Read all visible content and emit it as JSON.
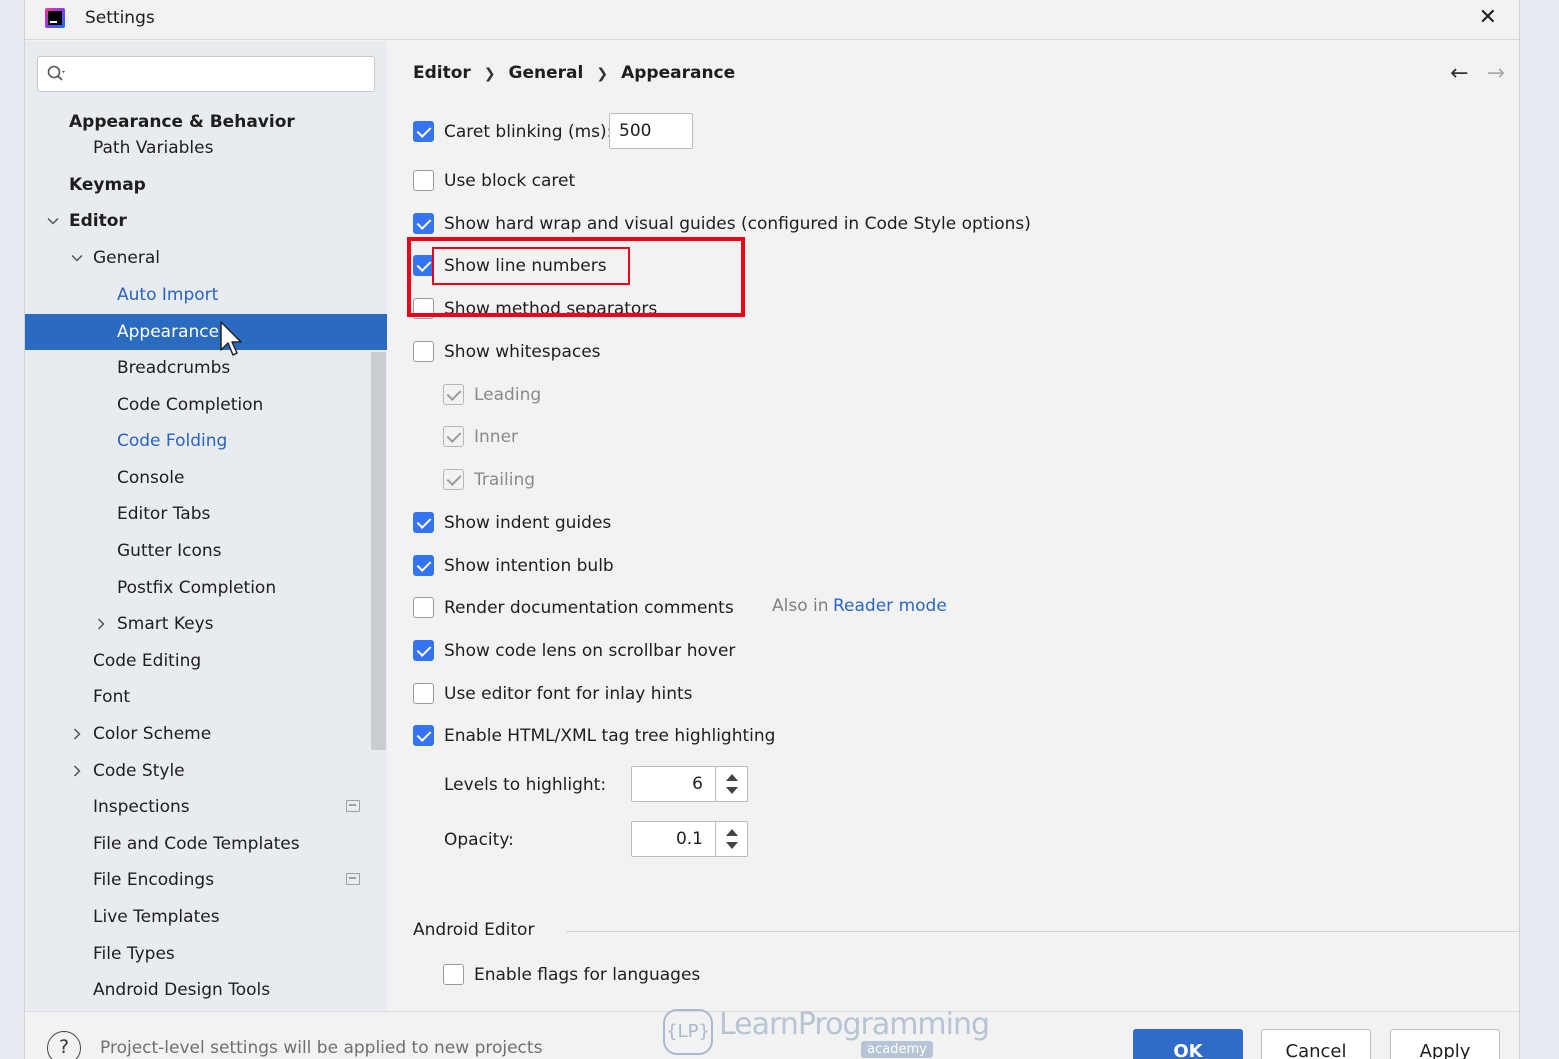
{
  "window": {
    "title": "Settings"
  },
  "sidebar": {
    "search": {
      "placeholder": ""
    },
    "items": [
      {
        "label": "Appearance & Behavior"
      },
      {
        "label": "Path Variables"
      },
      {
        "label": "Keymap"
      },
      {
        "label": "Editor"
      },
      {
        "label": "General"
      },
      {
        "label": "Auto Import"
      },
      {
        "label": "Appearance"
      },
      {
        "label": "Breadcrumbs"
      },
      {
        "label": "Code Completion"
      },
      {
        "label": "Code Folding"
      },
      {
        "label": "Console"
      },
      {
        "label": "Editor Tabs"
      },
      {
        "label": "Gutter Icons"
      },
      {
        "label": "Postfix Completion"
      },
      {
        "label": "Smart Keys"
      },
      {
        "label": "Code Editing"
      },
      {
        "label": "Font"
      },
      {
        "label": "Color Scheme"
      },
      {
        "label": "Code Style"
      },
      {
        "label": "Inspections"
      },
      {
        "label": "File and Code Templates"
      },
      {
        "label": "File Encodings"
      },
      {
        "label": "Live Templates"
      },
      {
        "label": "File Types"
      },
      {
        "label": "Android Design Tools"
      }
    ]
  },
  "breadcrumb": [
    "Editor",
    "General",
    "Appearance"
  ],
  "options": [
    {
      "label": "Caret blinking (ms):",
      "checked": true
    },
    {
      "label": "Use block caret",
      "checked": false
    },
    {
      "label": "Show hard wrap and visual guides (configured in Code Style options)",
      "checked": true
    },
    {
      "label": "Show line numbers",
      "checked": true
    },
    {
      "label": "Show method separators",
      "checked": false
    },
    {
      "label": "Show whitespaces",
      "checked": false
    },
    {
      "label": "Leading",
      "checked": true
    },
    {
      "label": "Inner",
      "checked": true
    },
    {
      "label": "Trailing",
      "checked": true
    },
    {
      "label": "Show indent guides",
      "checked": true
    },
    {
      "label": "Show intention bulb",
      "checked": true
    },
    {
      "label": "Render documentation comments",
      "checked": false
    },
    {
      "label": "Show code lens on scrollbar hover",
      "checked": true
    },
    {
      "label": "Use editor font for inlay hints",
      "checked": false
    },
    {
      "label": "Enable HTML/XML tag tree highlighting",
      "checked": true
    },
    {
      "label": "Enable flags for languages",
      "checked": false
    }
  ],
  "caret_blinking_value": "500",
  "also_in": {
    "prefix": "Also in",
    "link": "Reader mode"
  },
  "levels": {
    "label": "Levels to highlight:",
    "value": "6"
  },
  "opacity": {
    "label": "Opacity:",
    "value": "0.1"
  },
  "section_android": "Android Editor",
  "footer": {
    "help": "?",
    "note": "Project-level settings will be applied to new projects",
    "ok": "OK",
    "cancel": "Cancel",
    "apply": "Apply"
  },
  "watermark": {
    "badge": "{LP}",
    "text": "LearnProgramming",
    "sub": "academy"
  },
  "colors": {
    "accent": "#2b6bbf",
    "checkbox": "#3574f0",
    "highlight": "#f00019",
    "link": "#2863c0"
  }
}
